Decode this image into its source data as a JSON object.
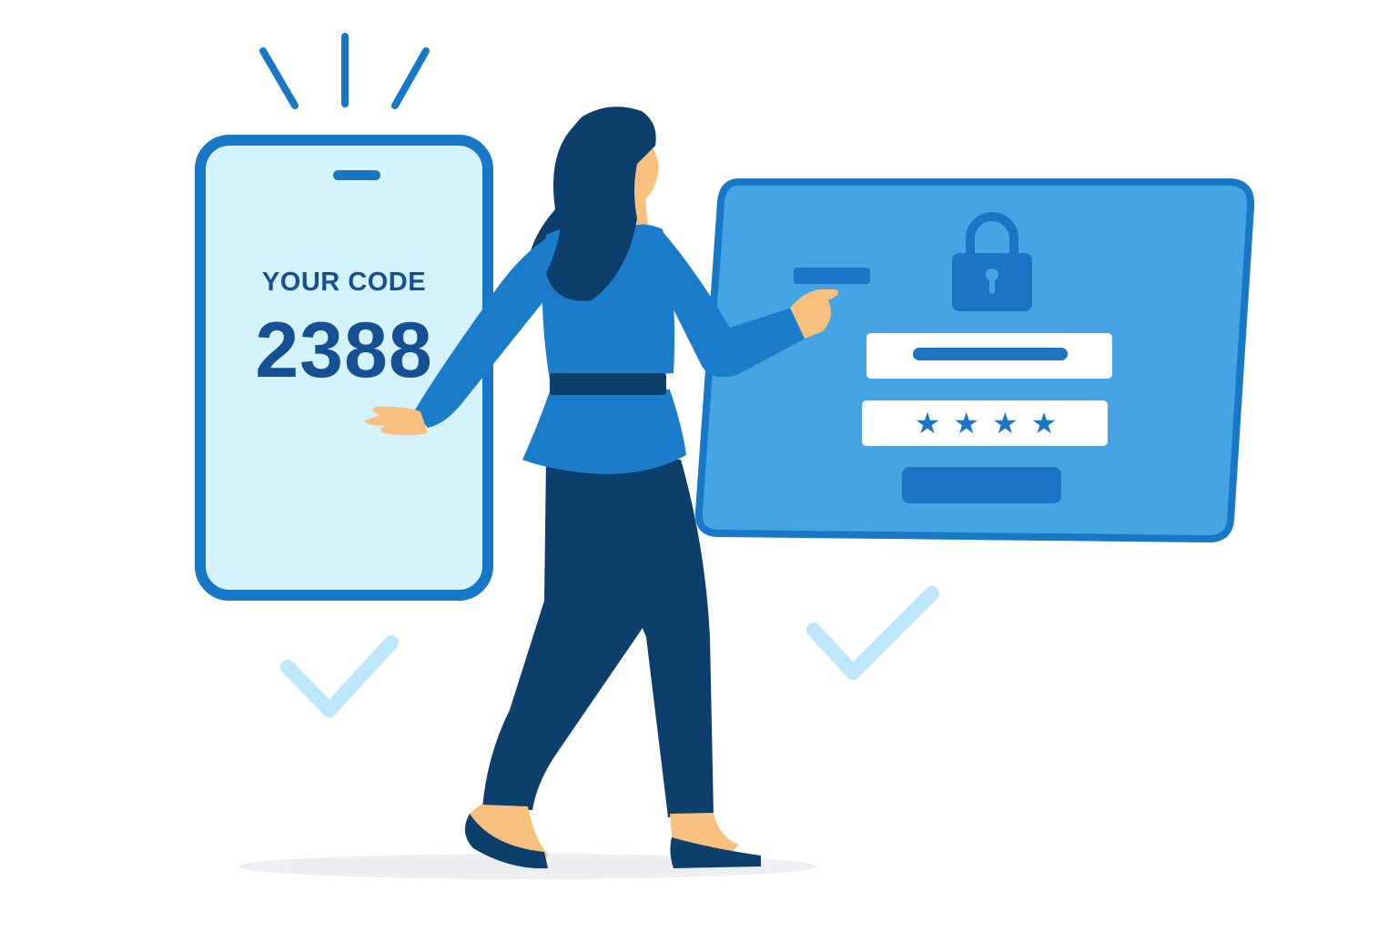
{
  "phone": {
    "label": "YOUR CODE",
    "code": "2388"
  },
  "login_form": {
    "password_mask": [
      "★",
      "★",
      "★",
      "★"
    ]
  },
  "icons": {
    "lock": "padlock-icon",
    "checkmarks": [
      "checkmark-icon",
      "checkmark-icon"
    ],
    "notification_rays": "notification-rays-icon"
  },
  "colors": {
    "primary_blue": "#1878c8",
    "panel_blue": "#45a5e4",
    "dark_navy": "#0c3f6b",
    "phone_screen": "#d4f3fd",
    "check_light": "#bde6fa",
    "skin": "#f7c07e"
  }
}
